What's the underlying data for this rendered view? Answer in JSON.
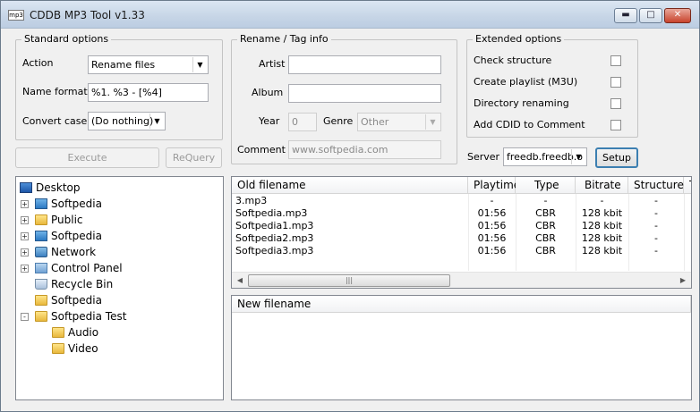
{
  "window": {
    "title": "CDDB MP3 Tool v1.33",
    "icon_text": "mp3"
  },
  "caption_buttons": {
    "minimize": "▬",
    "maximize": "□",
    "close": "✕"
  },
  "standard": {
    "title": "Standard options",
    "action_label": "Action",
    "action_value": "Rename files",
    "name_format_label": "Name format",
    "name_format_value": "%1. %3 - [%4]",
    "convert_case_label": "Convert case",
    "convert_case_value": "(Do nothing)"
  },
  "buttons": {
    "execute": "Execute",
    "requery": "ReQuery",
    "setup": "Setup"
  },
  "rename": {
    "title": "Rename / Tag info",
    "artist_label": "Artist",
    "artist_value": "",
    "album_label": "Album",
    "album_value": "",
    "year_label": "Year",
    "year_value": "0",
    "genre_label": "Genre",
    "genre_value": "Other",
    "comment_label": "Comment",
    "comment_value": "www.softpedia.com"
  },
  "extended": {
    "title": "Extended options",
    "options": [
      {
        "label": "Check structure",
        "checked": false
      },
      {
        "label": "Create playlist (M3U)",
        "checked": false
      },
      {
        "label": "Directory renaming",
        "checked": false
      },
      {
        "label": "Add CDID to Comment",
        "checked": false
      }
    ],
    "server_label": "Server",
    "server_value": "freedb.freedb.o"
  },
  "tree": [
    {
      "label": "Desktop",
      "icon": "desktop-icon",
      "expander": ""
    },
    {
      "label": "Softpedia",
      "icon": "monitor-icon",
      "expander": "+"
    },
    {
      "label": "Public",
      "icon": "folder-icon",
      "expander": "+"
    },
    {
      "label": "Softpedia",
      "icon": "monitor-icon",
      "expander": "+"
    },
    {
      "label": "Network",
      "icon": "network-icon",
      "expander": "+"
    },
    {
      "label": "Control Panel",
      "icon": "control-panel-icon",
      "expander": "+"
    },
    {
      "label": "Recycle Bin",
      "icon": "recycle-bin-icon",
      "expander": ""
    },
    {
      "label": "Softpedia",
      "icon": "folder-icon",
      "expander": ""
    },
    {
      "label": "Softpedia Test",
      "icon": "folder-icon",
      "expander": "-"
    },
    {
      "label": "Audio",
      "icon": "folder-icon",
      "expander": ""
    },
    {
      "label": "Video",
      "icon": "folder-icon",
      "expander": ""
    }
  ],
  "old_list": {
    "columns": [
      "Old filename",
      "Playtime",
      "Type",
      "Bitrate",
      "Structure",
      "T"
    ],
    "rows": [
      [
        "3.mp3",
        "-",
        "-",
        "-",
        "-"
      ],
      [
        "Softpedia.mp3",
        "01:56",
        "CBR",
        "128 kbit",
        "-"
      ],
      [
        "Softpedia1.mp3",
        "01:56",
        "CBR",
        "128 kbit",
        "-"
      ],
      [
        "Softpedia2.mp3",
        "01:56",
        "CBR",
        "128 kbit",
        "-"
      ],
      [
        "Softpedia3.mp3",
        "01:56",
        "CBR",
        "128 kbit",
        "-"
      ]
    ],
    "scroll": {
      "left": "◀",
      "right": "▶",
      "grip": "|||"
    }
  },
  "new_list": {
    "columns": [
      "New filename"
    ]
  }
}
